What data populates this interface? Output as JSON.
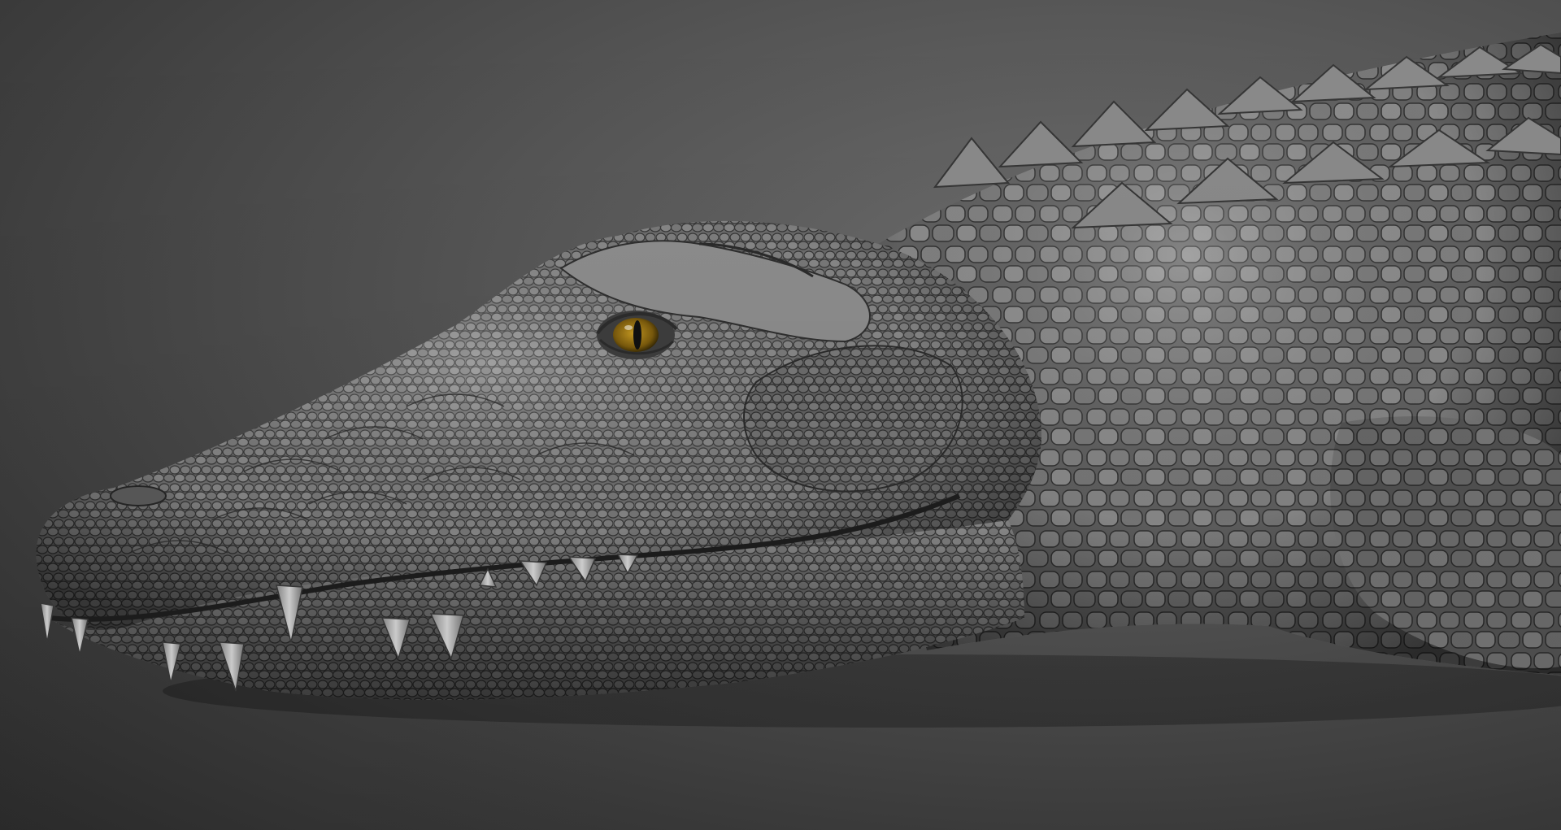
{
  "scene": {
    "subject": "crocodile-sculpt",
    "colors": {
      "background_center": "#6e6e6e",
      "background_edge": "#2e2e2e",
      "skin_light": "#9a9a9a",
      "skin_mid": "#6f6f6f",
      "skin_dark": "#3b3b3b",
      "eye_iris": "#8a6a10",
      "eye_pupil": "#111111",
      "teeth": "#c9c9c9"
    }
  }
}
